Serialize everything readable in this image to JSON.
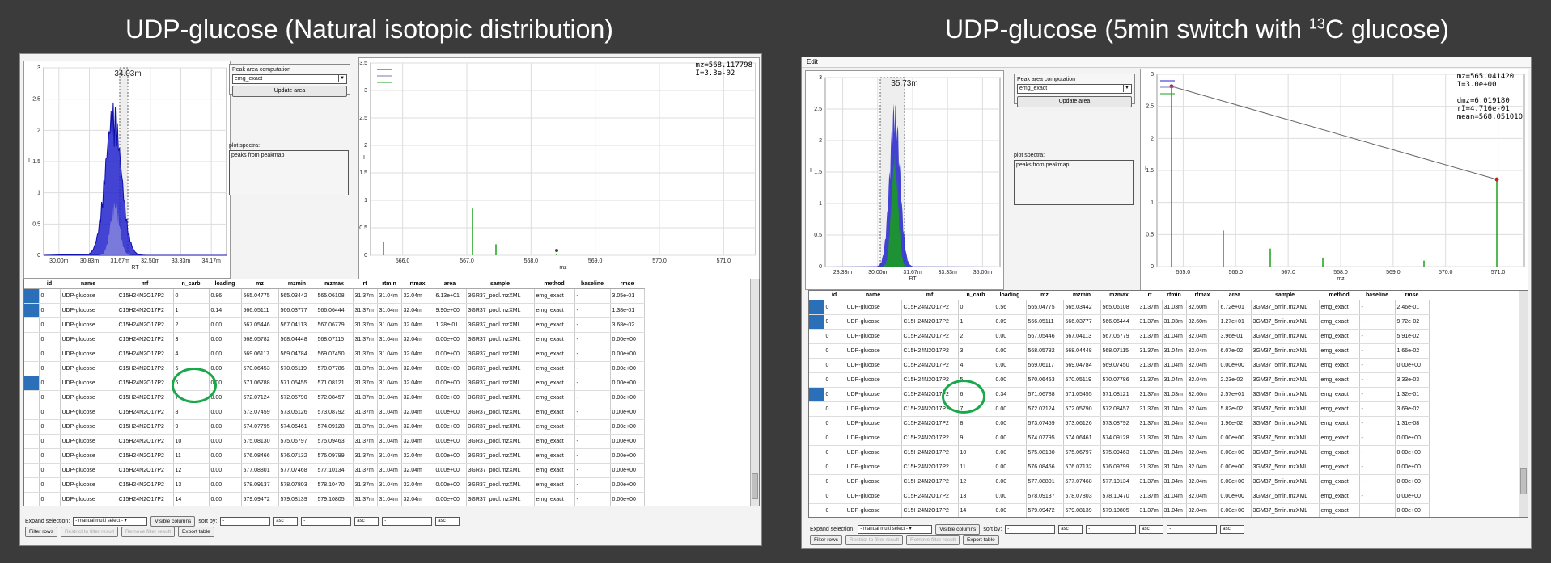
{
  "left": {
    "title": "UDP-glucose (Natural isotopic distribution)",
    "rt_plot": {
      "label": "34.03m",
      "xlabel": "RT",
      "ylabel": "I",
      "xticks": [
        "30.00m",
        "30.83m",
        "31.67m",
        "32.50m",
        "33.33m",
        "34.17m"
      ],
      "yticks": [
        "0",
        "0.5",
        "1",
        "1.5",
        "2",
        "2.5",
        "3"
      ]
    },
    "peak_area": {
      "label": "Peak area computation",
      "method": "emg_exact",
      "update_button": "Update area"
    },
    "plot_spectra": {
      "label": "plot spectra:",
      "item": "peaks from peakmap"
    },
    "spec_plot": {
      "readout": "mz=568.117798\nI=3.3e-02",
      "xlabel": "mz",
      "ylabel": "I",
      "xticks": [
        "566.0",
        "567.0",
        "568.0",
        "569.0",
        "570.0",
        "571.0"
      ],
      "yticks": [
        "0",
        "0.5",
        "1",
        "1.5",
        "2",
        "2.5",
        "3",
        "3.5"
      ]
    },
    "rows": [
      [
        "0",
        "UDP-glucose",
        "C15H24N2O17P2",
        "0",
        "0.86",
        "565.04775",
        "565.03442",
        "565.06108",
        "31.37m",
        "31.04m",
        "32.04m",
        "6.13e+01",
        "3GR37_pool.mzXML",
        "emg_exact",
        "-",
        "3.05e-01"
      ],
      [
        "0",
        "UDP-glucose",
        "C15H24N2O17P2",
        "1",
        "0.14",
        "566.05111",
        "566.03777",
        "566.06444",
        "31.37m",
        "31.04m",
        "32.04m",
        "9.90e+00",
        "3GR37_pool.mzXML",
        "emg_exact",
        "-",
        "1.38e-01"
      ],
      [
        "0",
        "UDP-glucose",
        "C15H24N2O17P2",
        "2",
        "0.00",
        "567.05446",
        "567.04113",
        "567.06779",
        "31.37m",
        "31.04m",
        "32.04m",
        "1.28e-01",
        "3GR37_pool.mzXML",
        "emg_exact",
        "-",
        "3.68e-02"
      ],
      [
        "0",
        "UDP-glucose",
        "C15H24N2O17P2",
        "3",
        "0.00",
        "568.05782",
        "568.04448",
        "568.07115",
        "31.37m",
        "31.04m",
        "32.04m",
        "0.00e+00",
        "3GR37_pool.mzXML",
        "emg_exact",
        "-",
        "0.00e+00"
      ],
      [
        "0",
        "UDP-glucose",
        "C15H24N2O17P2",
        "4",
        "0.00",
        "569.06117",
        "569.04784",
        "569.07450",
        "31.37m",
        "31.04m",
        "32.04m",
        "0.00e+00",
        "3GR37_pool.mzXML",
        "emg_exact",
        "-",
        "0.00e+00"
      ],
      [
        "0",
        "UDP-glucose",
        "C15H24N2O17P2",
        "5",
        "0.00",
        "570.06453",
        "570.05119",
        "570.07786",
        "31.37m",
        "31.04m",
        "32.04m",
        "0.00e+00",
        "3GR37_pool.mzXML",
        "emg_exact",
        "-",
        "0.00e+00"
      ],
      [
        "0",
        "UDP-glucose",
        "C15H24N2O17P2",
        "6",
        "0.00",
        "571.06788",
        "571.05455",
        "571.08121",
        "31.37m",
        "31.04m",
        "32.04m",
        "0.00e+00",
        "3GR37_pool.mzXML",
        "emg_exact",
        "-",
        "0.00e+00"
      ],
      [
        "0",
        "UDP-glucose",
        "C15H24N2O17P2",
        "7",
        "0.00",
        "572.07124",
        "572.05790",
        "572.08457",
        "31.37m",
        "31.04m",
        "32.04m",
        "0.00e+00",
        "3GR37_pool.mzXML",
        "emg_exact",
        "-",
        "0.00e+00"
      ],
      [
        "0",
        "UDP-glucose",
        "C15H24N2O17P2",
        "8",
        "0.00",
        "573.07459",
        "573.06126",
        "573.08792",
        "31.37m",
        "31.04m",
        "32.04m",
        "0.00e+00",
        "3GR37_pool.mzXML",
        "emg_exact",
        "-",
        "0.00e+00"
      ],
      [
        "0",
        "UDP-glucose",
        "C15H24N2O17P2",
        "9",
        "0.00",
        "574.07795",
        "574.06461",
        "574.09128",
        "31.37m",
        "31.04m",
        "32.04m",
        "0.00e+00",
        "3GR37_pool.mzXML",
        "emg_exact",
        "-",
        "0.00e+00"
      ],
      [
        "0",
        "UDP-glucose",
        "C15H24N2O17P2",
        "10",
        "0.00",
        "575.08130",
        "575.06797",
        "575.09463",
        "31.37m",
        "31.04m",
        "32.04m",
        "0.00e+00",
        "3GR37_pool.mzXML",
        "emg_exact",
        "-",
        "0.00e+00"
      ],
      [
        "0",
        "UDP-glucose",
        "C15H24N2O17P2",
        "11",
        "0.00",
        "576.08466",
        "576.07132",
        "576.09799",
        "31.37m",
        "31.04m",
        "32.04m",
        "0.00e+00",
        "3GR37_pool.mzXML",
        "emg_exact",
        "-",
        "0.00e+00"
      ],
      [
        "0",
        "UDP-glucose",
        "C15H24N2O17P2",
        "12",
        "0.00",
        "577.08801",
        "577.07468",
        "577.10134",
        "31.37m",
        "31.04m",
        "32.04m",
        "0.00e+00",
        "3GR37_pool.mzXML",
        "emg_exact",
        "-",
        "0.00e+00"
      ],
      [
        "0",
        "UDP-glucose",
        "C15H24N2O17P2",
        "13",
        "0.00",
        "578.09137",
        "578.07803",
        "578.10470",
        "31.37m",
        "31.04m",
        "32.04m",
        "0.00e+00",
        "3GR37_pool.mzXML",
        "emg_exact",
        "-",
        "0.00e+00"
      ],
      [
        "0",
        "UDP-glucose",
        "C15H24N2O17P2",
        "14",
        "0.00",
        "579.09472",
        "579.08139",
        "579.10805",
        "31.37m",
        "31.04m",
        "32.04m",
        "0.00e+00",
        "3GR37_pool.mzXML",
        "emg_exact",
        "-",
        "0.00e+00"
      ]
    ]
  },
  "right": {
    "title_main": "UDP-glucose (5min switch with ",
    "title_sup": "13",
    "title_end": "C glucose)",
    "menu": "Edit",
    "rt_plot": {
      "label": "35.73m",
      "xlabel": "RT",
      "ylabel": "I",
      "xticks": [
        "28.33m",
        "30.00m",
        "31.67m",
        "33.33m",
        "35.00m"
      ],
      "yticks": [
        "0",
        "0.5",
        "1",
        "1.5",
        "2",
        "2.5",
        "3"
      ]
    },
    "peak_area": {
      "label": "Peak area computation",
      "method": "emg_exact",
      "update_button": "Update area"
    },
    "plot_spectra": {
      "label": "plot spectra:",
      "item": "peaks from peakmap"
    },
    "spec_plot": {
      "readout": "mz=565.041420\nI=3.0e+00\n\ndmz=6.019180\nrI=4.716e-01\nmean=568.051010",
      "xlabel": "mz",
      "ylabel": "I",
      "xticks": [
        "565.0",
        "566.0",
        "567.0",
        "568.0",
        "569.0",
        "570.0",
        "571.0"
      ],
      "yticks": [
        "0",
        "0.5",
        "1",
        "1.5",
        "2",
        "2.5",
        "3"
      ]
    },
    "rows": [
      [
        "0",
        "UDP-glucose",
        "C15H24N2O17P2",
        "0",
        "0.56",
        "565.04775",
        "565.03442",
        "565.06108",
        "31.37m",
        "31.03m",
        "32.60m",
        "6.72e+01",
        "3GM37_5min.mzXML",
        "emg_exact",
        "-",
        "2.46e-01"
      ],
      [
        "0",
        "UDP-glucose",
        "C15H24N2O17P2",
        "1",
        "0.09",
        "566.05111",
        "566.03777",
        "566.06444",
        "31.37m",
        "31.03m",
        "32.60m",
        "1.27e+01",
        "3GM37_5min.mzXML",
        "emg_exact",
        "-",
        "9.72e-02"
      ],
      [
        "0",
        "UDP-glucose",
        "C15H24N2O17P2",
        "2",
        "0.00",
        "567.05446",
        "567.04113",
        "567.06779",
        "31.37m",
        "31.04m",
        "32.04m",
        "3.96e-01",
        "3GM37_5min.mzXML",
        "emg_exact",
        "-",
        "5.91e-02"
      ],
      [
        "0",
        "UDP-glucose",
        "C15H24N2O17P2",
        "3",
        "0.00",
        "568.05782",
        "568.04448",
        "568.07115",
        "31.37m",
        "31.04m",
        "32.04m",
        "6.07e-02",
        "3GM37_5min.mzXML",
        "emg_exact",
        "-",
        "1.66e-02"
      ],
      [
        "0",
        "UDP-glucose",
        "C15H24N2O17P2",
        "4",
        "0.00",
        "569.06117",
        "569.04784",
        "569.07450",
        "31.37m",
        "31.04m",
        "32.04m",
        "0.00e+00",
        "3GM37_5min.mzXML",
        "emg_exact",
        "-",
        "0.00e+00"
      ],
      [
        "0",
        "UDP-glucose",
        "C15H24N2O17P2",
        "5",
        "0.00",
        "570.06453",
        "570.05119",
        "570.07786",
        "31.37m",
        "31.04m",
        "32.04m",
        "2.23e-02",
        "3GM37_5min.mzXML",
        "emg_exact",
        "-",
        "3.33e-03"
      ],
      [
        "0",
        "UDP-glucose",
        "C15H24N2O17P2",
        "6",
        "0.34",
        "571.06788",
        "571.05455",
        "571.08121",
        "31.37m",
        "31.03m",
        "32.60m",
        "2.57e+01",
        "3GM37_5min.mzXML",
        "emg_exact",
        "-",
        "1.32e-01"
      ],
      [
        "0",
        "UDP-glucose",
        "C15H24N2O17P2",
        "7",
        "0.00",
        "572.07124",
        "572.05790",
        "572.08457",
        "31.37m",
        "31.04m",
        "32.04m",
        "5.82e-02",
        "3GM37_5min.mzXML",
        "emg_exact",
        "-",
        "3.69e-02"
      ],
      [
        "0",
        "UDP-glucose",
        "C15H24N2O17P2",
        "8",
        "0.00",
        "573.07459",
        "573.06126",
        "573.08792",
        "31.37m",
        "31.04m",
        "32.04m",
        "1.96e-02",
        "3GM37_5min.mzXML",
        "emg_exact",
        "-",
        "1.31e-08"
      ],
      [
        "0",
        "UDP-glucose",
        "C15H24N2O17P2",
        "9",
        "0.00",
        "574.07795",
        "574.06461",
        "574.09128",
        "31.37m",
        "31.04m",
        "32.04m",
        "0.00e+00",
        "3GM37_5min.mzXML",
        "emg_exact",
        "-",
        "0.00e+00"
      ],
      [
        "0",
        "UDP-glucose",
        "C15H24N2O17P2",
        "10",
        "0.00",
        "575.08130",
        "575.06797",
        "575.09463",
        "31.37m",
        "31.04m",
        "32.04m",
        "0.00e+00",
        "3GM37_5min.mzXML",
        "emg_exact",
        "-",
        "0.00e+00"
      ],
      [
        "0",
        "UDP-glucose",
        "C15H24N2O17P2",
        "11",
        "0.00",
        "576.08466",
        "576.07132",
        "576.09799",
        "31.37m",
        "31.04m",
        "32.04m",
        "0.00e+00",
        "3GM37_5min.mzXML",
        "emg_exact",
        "-",
        "0.00e+00"
      ],
      [
        "0",
        "UDP-glucose",
        "C15H24N2O17P2",
        "12",
        "0.00",
        "577.08801",
        "577.07468",
        "577.10134",
        "31.37m",
        "31.04m",
        "32.04m",
        "0.00e+00",
        "3GM37_5min.mzXML",
        "emg_exact",
        "-",
        "0.00e+00"
      ],
      [
        "0",
        "UDP-glucose",
        "C15H24N2O17P2",
        "13",
        "0.00",
        "578.09137",
        "578.07803",
        "578.10470",
        "31.37m",
        "31.04m",
        "32.04m",
        "0.00e+00",
        "3GM37_5min.mzXML",
        "emg_exact",
        "-",
        "0.00e+00"
      ],
      [
        "0",
        "UDP-glucose",
        "C15H24N2O17P2",
        "14",
        "0.00",
        "579.09472",
        "579.08139",
        "579.10805",
        "31.37m",
        "31.04m",
        "32.04m",
        "0.00e+00",
        "3GM37_5min.mzXML",
        "emg_exact",
        "-",
        "0.00e+00"
      ]
    ]
  },
  "columns": [
    "id",
    "name",
    "mf",
    "n_carb",
    "loading",
    "mz",
    "mzmin",
    "mzmax",
    "rt",
    "rtmin",
    "rtmax",
    "area",
    "sample",
    "method",
    "baseline",
    "rmse"
  ],
  "bottom": {
    "expand_label": "Expand selection:",
    "expand_value": "- manual multi select -",
    "visible_columns": "Visible columns",
    "sort_label": "sort by:",
    "sort_value": "-",
    "asc": "asc",
    "filter_rows": "Filter rows",
    "restrict": "Restrict to filter result",
    "remove_filter": "Remove filter result",
    "export": "Export table"
  },
  "colors": {
    "blue": "#1f1fd0",
    "green": "#1aa01a",
    "highlight": "#1aa84a",
    "selection": "#2b6fb8"
  }
}
